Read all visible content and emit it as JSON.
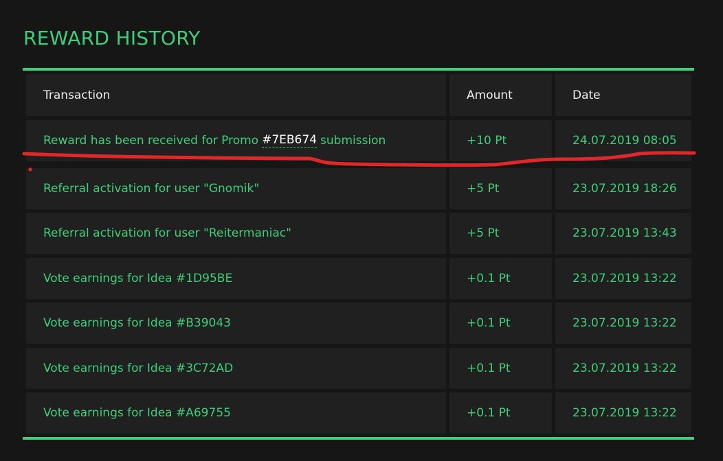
{
  "page": {
    "title": "REWARD HISTORY"
  },
  "table": {
    "headers": {
      "transaction": "Transaction",
      "amount": "Amount",
      "date": "Date"
    },
    "rows": [
      {
        "transaction_prefix": "Reward has been received for Promo",
        "promo_code": "#7EB674",
        "transaction_suffix": "submission",
        "amount": "+10 Pt",
        "date": "24.07.2019 08:05"
      },
      {
        "transaction": "Referral activation for user \"Gnomik\"",
        "amount": "+5 Pt",
        "date": "23.07.2019 18:26"
      },
      {
        "transaction": "Referral activation for user \"Reitermaniac\"",
        "amount": "+5 Pt",
        "date": "23.07.2019 13:43"
      },
      {
        "transaction": "Vote earnings for Idea #1D95BE",
        "amount": "+0.1 Pt",
        "date": "23.07.2019 13:22"
      },
      {
        "transaction": "Vote earnings for Idea #B39043",
        "amount": "+0.1 Pt",
        "date": "23.07.2019 13:22"
      },
      {
        "transaction": "Vote earnings for Idea #3C72AD",
        "amount": "+0.1 Pt",
        "date": "23.07.2019 13:22"
      },
      {
        "transaction": "Vote earnings for Idea #A69755",
        "amount": "+0.1 Pt",
        "date": "23.07.2019 13:22"
      }
    ]
  },
  "colors": {
    "background": "#161616",
    "cell_background": "#202020",
    "accent_green": "#3ecf7a",
    "header_text": "#ededed",
    "promo_code_text": "#ffffff",
    "annotation_red": "#e0282a"
  }
}
